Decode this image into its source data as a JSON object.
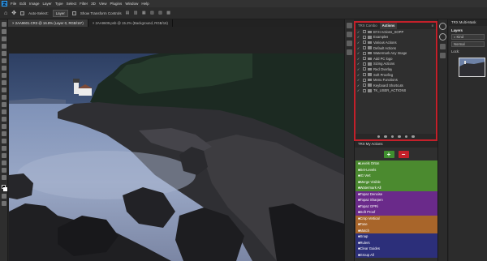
{
  "menubar": {
    "logo": "Ps",
    "items": [
      "File",
      "Edit",
      "Image",
      "Layer",
      "Type",
      "Select",
      "Filter",
      "3D",
      "View",
      "Plugins",
      "Window",
      "Help"
    ]
  },
  "options": {
    "auto_select_label": "Auto-Select:",
    "layer_select": "Layer",
    "transform_label": "Show Transform Controls"
  },
  "tabs": [
    {
      "label": "2AA9601.CR3 @ 16.8% (Layer 0, RGB/16*)",
      "active": true
    },
    {
      "label": "2AA9609.psb @ 15.2% (Background, RGB/16)",
      "active": false
    }
  ],
  "actions_panel": {
    "tabs": [
      "TRX Combo",
      "Actions"
    ],
    "items": [
      {
        "label": "BYH Actions_SOPP",
        "checked": true
      },
      {
        "label": "Examples",
        "checked": true
      },
      {
        "label": "Various Actions",
        "checked": true
      },
      {
        "label": "Default Actions",
        "checked": true
      },
      {
        "label": "Watermark Any Image",
        "checked": true
      },
      {
        "label": "Add PC logo",
        "checked": true
      },
      {
        "label": "Sizing Actions",
        "checked": true
      },
      {
        "label": "Red Overlay",
        "checked": true
      },
      {
        "label": "Soft Proofing",
        "checked": true
      },
      {
        "label": "Menu Functions",
        "checked": true
      },
      {
        "label": "Keyboard Shortcuts",
        "checked": true
      },
      {
        "label": "TK_USER_ACTIONS",
        "checked": true
      }
    ]
  },
  "my_actions": {
    "title": "TRX My Actions",
    "add_label": "+",
    "remove_label": "−",
    "items": [
      {
        "label": "■Levels Orton",
        "color": "#4b8a2f"
      },
      {
        "label": "■Set-Levels",
        "color": "#4b8a2f"
      },
      {
        "label": "■IG Vert",
        "color": "#4b8a2f"
      },
      {
        "label": "■Merge Visible",
        "color": "#4b8a2f"
      },
      {
        "label": "■Watermark All",
        "color": "#4b8a2f"
      },
      {
        "label": "■Topaz Denoise",
        "color": "#6a2a8a"
      },
      {
        "label": "■Topaz Sharpen",
        "color": "#6a2a8a"
      },
      {
        "label": "■Topaz GPRi",
        "color": "#6a2a8a"
      },
      {
        "label": "■Soft Proof",
        "color": "#6a2a8a"
      },
      {
        "label": "■Crop Vertical",
        "color": "#a8652a"
      },
      {
        "label": "■Tone",
        "color": "#a8652a"
      },
      {
        "label": "■Match",
        "color": "#a8652a"
      },
      {
        "label": "■Snap",
        "color": "#2c2f7a"
      },
      {
        "label": "■Rulers",
        "color": "#2c2f7a"
      },
      {
        "label": "■Clear Guides",
        "color": "#2c2f7a"
      },
      {
        "label": "■Group All",
        "color": "#2c2f7a"
      }
    ]
  },
  "trx_panel": {
    "title": "TRX Multi-Mask",
    "layers_label": "Layers",
    "kind_field": "Kind",
    "blend_field": "Normal",
    "lock_label": "Lock:"
  },
  "colors": {
    "highlight_border": "#c3202a",
    "add_button": "#3f8f2f",
    "remove_button": "#c3202a"
  }
}
